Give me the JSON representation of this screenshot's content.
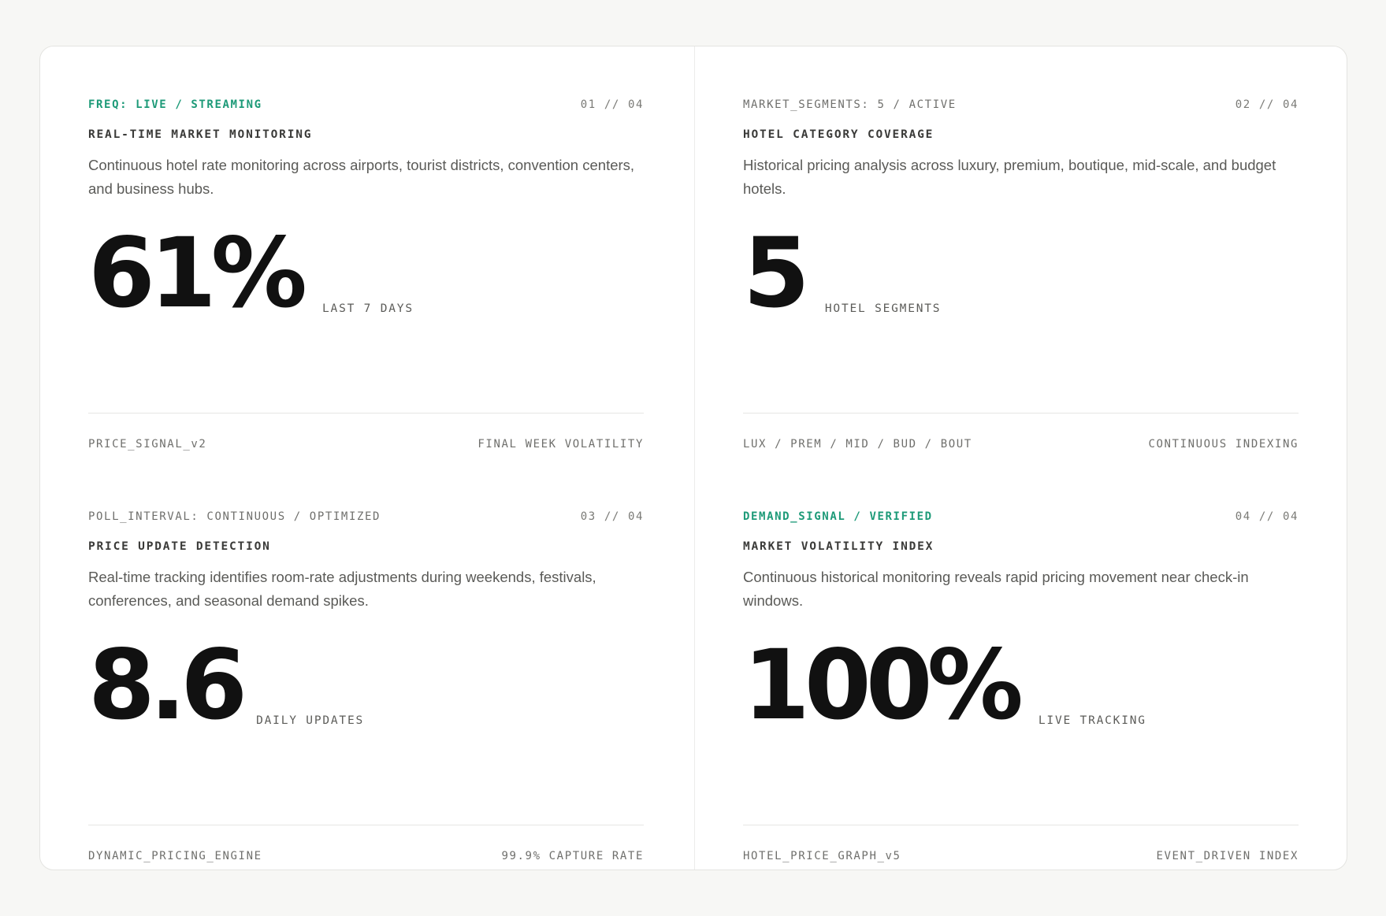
{
  "colors": {
    "accent": "#1d9a78",
    "background": "#f7f7f5",
    "panel": "#ffffff",
    "metric": "#111111"
  },
  "cards": [
    {
      "tag": "FREQ: LIVE / STREAMING",
      "counter": "01 // 04",
      "heading": "REAL-TIME MARKET MONITORING",
      "description": "Continuous hotel rate monitoring across airports, tourist districts, convention centers, and business hubs.",
      "metric": "61%",
      "metric_label": "LAST 7 DAYS",
      "footer_left": "PRICE_SIGNAL_v2",
      "footer_right": "FINAL WEEK VOLATILITY"
    },
    {
      "tag": "MARKET_SEGMENTS: 5 / ACTIVE",
      "counter": "02 // 04",
      "heading": "HOTEL CATEGORY COVERAGE",
      "description": "Historical pricing analysis across luxury, premium, boutique, mid-scale, and budget hotels.",
      "metric": "5",
      "metric_label": "HOTEL SEGMENTS",
      "footer_left": "LUX / PREM / MID / BUD / BOUT",
      "footer_right": "CONTINUOUS INDEXING"
    },
    {
      "tag": "POLL_INTERVAL: CONTINUOUS / OPTIMIZED",
      "counter": "03 // 04",
      "heading": "PRICE UPDATE DETECTION",
      "description": "Real-time tracking identifies room-rate adjustments during weekends, festivals, conferences, and seasonal demand spikes.",
      "metric": "8.6",
      "metric_label": "DAILY UPDATES",
      "footer_left": "DYNAMIC_PRICING_ENGINE",
      "footer_right": "99.9% CAPTURE RATE"
    },
    {
      "tag": "DEMAND_SIGNAL / VERIFIED",
      "counter": "04 // 04",
      "heading": "MARKET VOLATILITY INDEX",
      "description": "Continuous historical monitoring reveals rapid pricing movement near check-in windows.",
      "metric": "100%",
      "metric_label": "LIVE TRACKING",
      "footer_left": "HOTEL_PRICE_GRAPH_v5",
      "footer_right": "EVENT_DRIVEN INDEX"
    }
  ]
}
